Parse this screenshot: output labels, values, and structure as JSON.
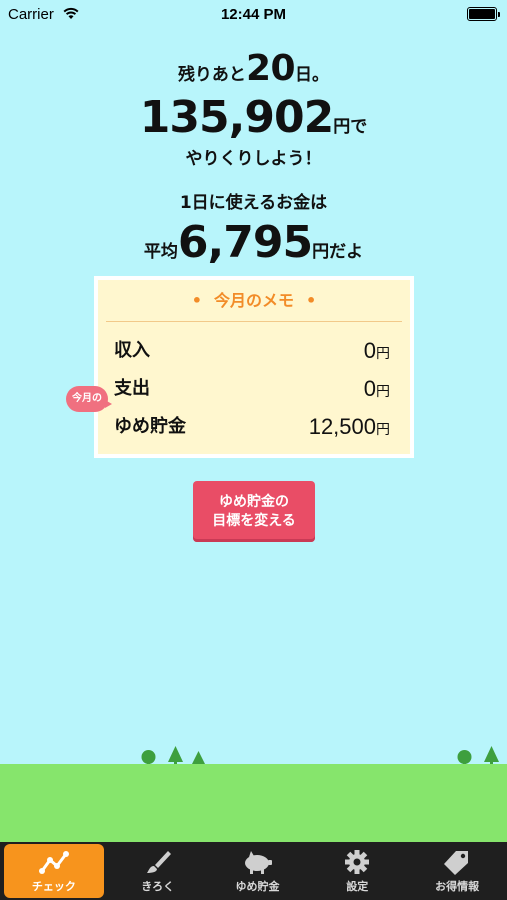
{
  "status_bar": {
    "carrier": "Carrier",
    "time": "12:44 PM"
  },
  "summary": {
    "days_prefix": "残りあと",
    "days_left": "20",
    "days_suffix": "日。",
    "budget_amount": "135,902",
    "budget_suffix": "円で",
    "tagline": "やりくりしよう！",
    "daily_label": "1日に使えるお金は",
    "average_prefix": "平均",
    "daily_amount": "6,795",
    "daily_suffix": "円だよ"
  },
  "memo": {
    "title": "今月のメモ",
    "bubble": "今月の",
    "unit": "円",
    "rows": [
      {
        "label": "収入",
        "value": "0"
      },
      {
        "label": "支出",
        "value": "0"
      },
      {
        "label": "ゆめ貯金",
        "value": "12,500"
      }
    ]
  },
  "goal_button": {
    "line1": "ゆめ貯金の",
    "line2": "目標を変える"
  },
  "tabs": [
    {
      "label": "チェック",
      "icon": "chart-line-icon",
      "active": true
    },
    {
      "label": "きろく",
      "icon": "brush-icon",
      "active": false
    },
    {
      "label": "ゆめ貯金",
      "icon": "piggy-bank-icon",
      "active": false
    },
    {
      "label": "設定",
      "icon": "gear-icon",
      "active": false
    },
    {
      "label": "お得情報",
      "icon": "price-tag-icon",
      "active": false
    }
  ],
  "colors": {
    "background": "#b8f5fb",
    "accent_orange": "#f7941d",
    "button_red": "#e94d66",
    "grass": "#86e56c",
    "memo_bg": "#fff7cf"
  }
}
